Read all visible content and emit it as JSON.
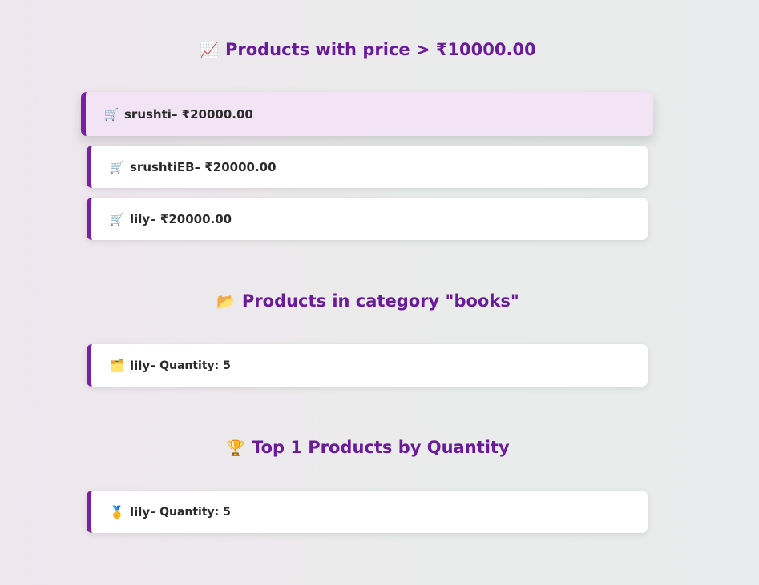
{
  "sections": [
    {
      "title_icon": "📈",
      "title": "Products with price > ₹10000.00",
      "items": [
        {
          "icon": "🛒",
          "name": "srushti",
          "text": " – ₹20000.00"
        },
        {
          "icon": "🛒",
          "name": "srushtiEB",
          "text": " – ₹20000.00"
        },
        {
          "icon": "🛒",
          "name": "lily",
          "text": " – ₹20000.00"
        }
      ]
    },
    {
      "title_icon": "📂",
      "title": "Products in category \"books\"",
      "items": [
        {
          "icon": "🗂️",
          "name": "lily",
          "text": " – Quantity: 5"
        }
      ]
    },
    {
      "title_icon": "🏆",
      "title": "Top 1 Products by Quantity",
      "items": [
        {
          "icon": "🥇",
          "name": "lily",
          "text": " – Quantity: 5"
        }
      ]
    }
  ],
  "colors": {
    "accent": "#7b1fa2",
    "title": "#6a1b9a",
    "hover_bg": "#f2e4f5"
  }
}
